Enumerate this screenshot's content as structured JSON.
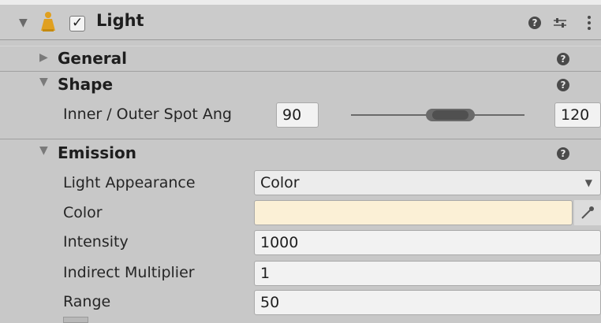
{
  "header": {
    "title": "Light",
    "enabled_checkmark": "✓"
  },
  "sections": {
    "general": {
      "title": "General"
    },
    "shape": {
      "title": "Shape",
      "spot_angle_label": "Inner / Outer Spot Ang",
      "inner_value": "90",
      "outer_value": "120"
    },
    "emission": {
      "title": "Emission",
      "light_appearance_label": "Light Appearance",
      "light_appearance_value": "Color",
      "color_label": "Color",
      "color_value": "#fbf0d6",
      "intensity_label": "Intensity",
      "intensity_value": "1000",
      "indirect_label": "Indirect Multiplier",
      "indirect_value": "1",
      "range_label": "Range",
      "range_value": "50"
    }
  },
  "icons": {
    "help": "?",
    "expanded": "▼",
    "collapsed": "▶",
    "dropdown_arrow": "▼",
    "settings_icon": "presets-icon",
    "menu_icon": "kebab-menu-icon",
    "light_icon": "spotlight-icon",
    "eyedropper_icon": "eyedropper-icon"
  }
}
